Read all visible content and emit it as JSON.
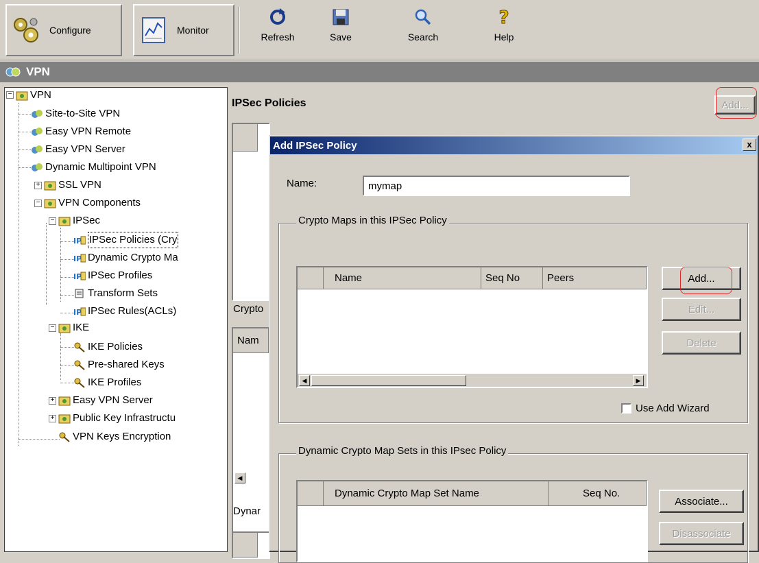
{
  "toolbar": {
    "configure": "Configure",
    "monitor": "Monitor",
    "refresh": "Refresh",
    "save": "Save",
    "search": "Search",
    "help": "Help"
  },
  "header": {
    "title": "VPN"
  },
  "tree": {
    "root": "VPN",
    "site_to_site": "Site-to-Site VPN",
    "easy_vpn_remote": "Easy VPN Remote",
    "easy_vpn_server": "Easy VPN Server",
    "dmvpn": "Dynamic Multipoint VPN",
    "ssl_vpn": "SSL VPN",
    "vpn_components": "VPN Components",
    "ipsec": "IPSec",
    "ipsec_policies": "IPSec Policies (Cry",
    "dynamic_crypto": "Dynamic Crypto Ma",
    "ipsec_profiles": "IPSec Profiles",
    "transform_sets": "Transform Sets",
    "ipsec_rules": "IPSec Rules(ACLs)",
    "ike": "IKE",
    "ike_policies": "IKE Policies",
    "preshared_keys": "Pre-shared Keys",
    "ike_profiles": "IKE Profiles",
    "easy_vpn_server2": "Easy VPN Server",
    "pki": "Public Key Infrastructu",
    "vpn_keys": "VPN Keys Encryption"
  },
  "main": {
    "title": "IPSec Policies",
    "add_button": "Add...",
    "crypto_label": "Crypto",
    "name_col": "Nam",
    "dynamic_label": "Dynar"
  },
  "dialog": {
    "title": "Add IPSec Policy",
    "close": "x",
    "name_label": "Name:",
    "name_value": "mymap",
    "crypto_group": "Crypto Maps in this IPSec Policy",
    "crypto_cols": {
      "name": "Name",
      "seq": "Seq No",
      "peers": "Peers"
    },
    "add": "Add...",
    "edit": "Edit...",
    "delete": "Delete",
    "use_wizard": "Use Add Wizard",
    "use_wizard_checked": false,
    "dynamic_group": "Dynamic Crypto Map Sets in this IPsec Policy",
    "dynamic_cols": {
      "name": "Dynamic Crypto Map Set Name",
      "seq": "Seq No."
    },
    "associate": "Associate...",
    "disassociate": "Disassociate"
  },
  "colors": {
    "title_start": "#0a246a",
    "title_end": "#a6caf0",
    "highlight_ring": "#e0282a",
    "header_bar": "#808080"
  }
}
